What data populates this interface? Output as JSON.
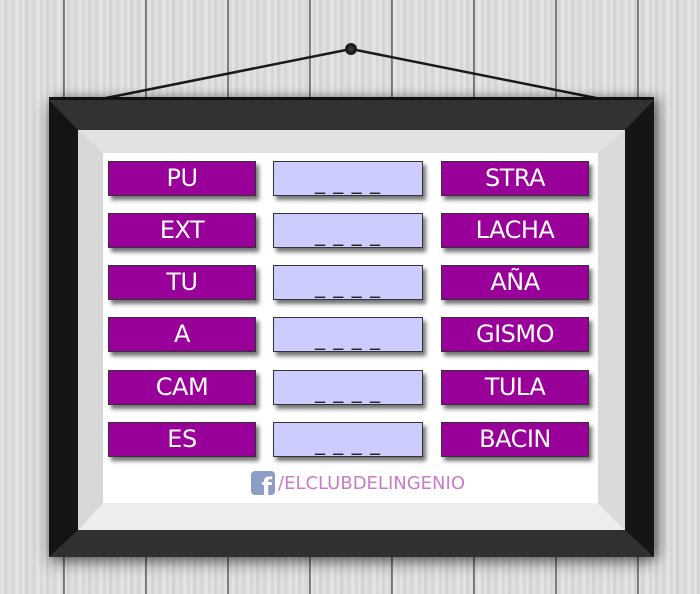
{
  "puzzle": {
    "rows": [
      {
        "prefix": "PU",
        "answer_blank": "_ _ _ _",
        "suffix": "STRA"
      },
      {
        "prefix": "EXT",
        "answer_blank": "_ _ _ _",
        "suffix": "LACHA"
      },
      {
        "prefix": "TU",
        "answer_blank": "_ _ _ _",
        "suffix": "AÑA"
      },
      {
        "prefix": "A",
        "answer_blank": "_ _ _ _",
        "suffix": "GISMO"
      },
      {
        "prefix": "CAM",
        "answer_blank": "_ _ _ _",
        "suffix": "TULA"
      },
      {
        "prefix": "ES",
        "answer_blank": "_ _ _ _",
        "suffix": "BACIN"
      }
    ]
  },
  "credit": {
    "icon": "facebook-icon",
    "icon_glyph": "f",
    "text": "/ELCLUBDELINGENIO"
  },
  "colors": {
    "tile_purple": "#990099",
    "blank_tile": "#ccccff",
    "credit_text": "#c97cc9",
    "facebook_icon": "#8c9dc6",
    "frame": "#2a2a2a"
  }
}
